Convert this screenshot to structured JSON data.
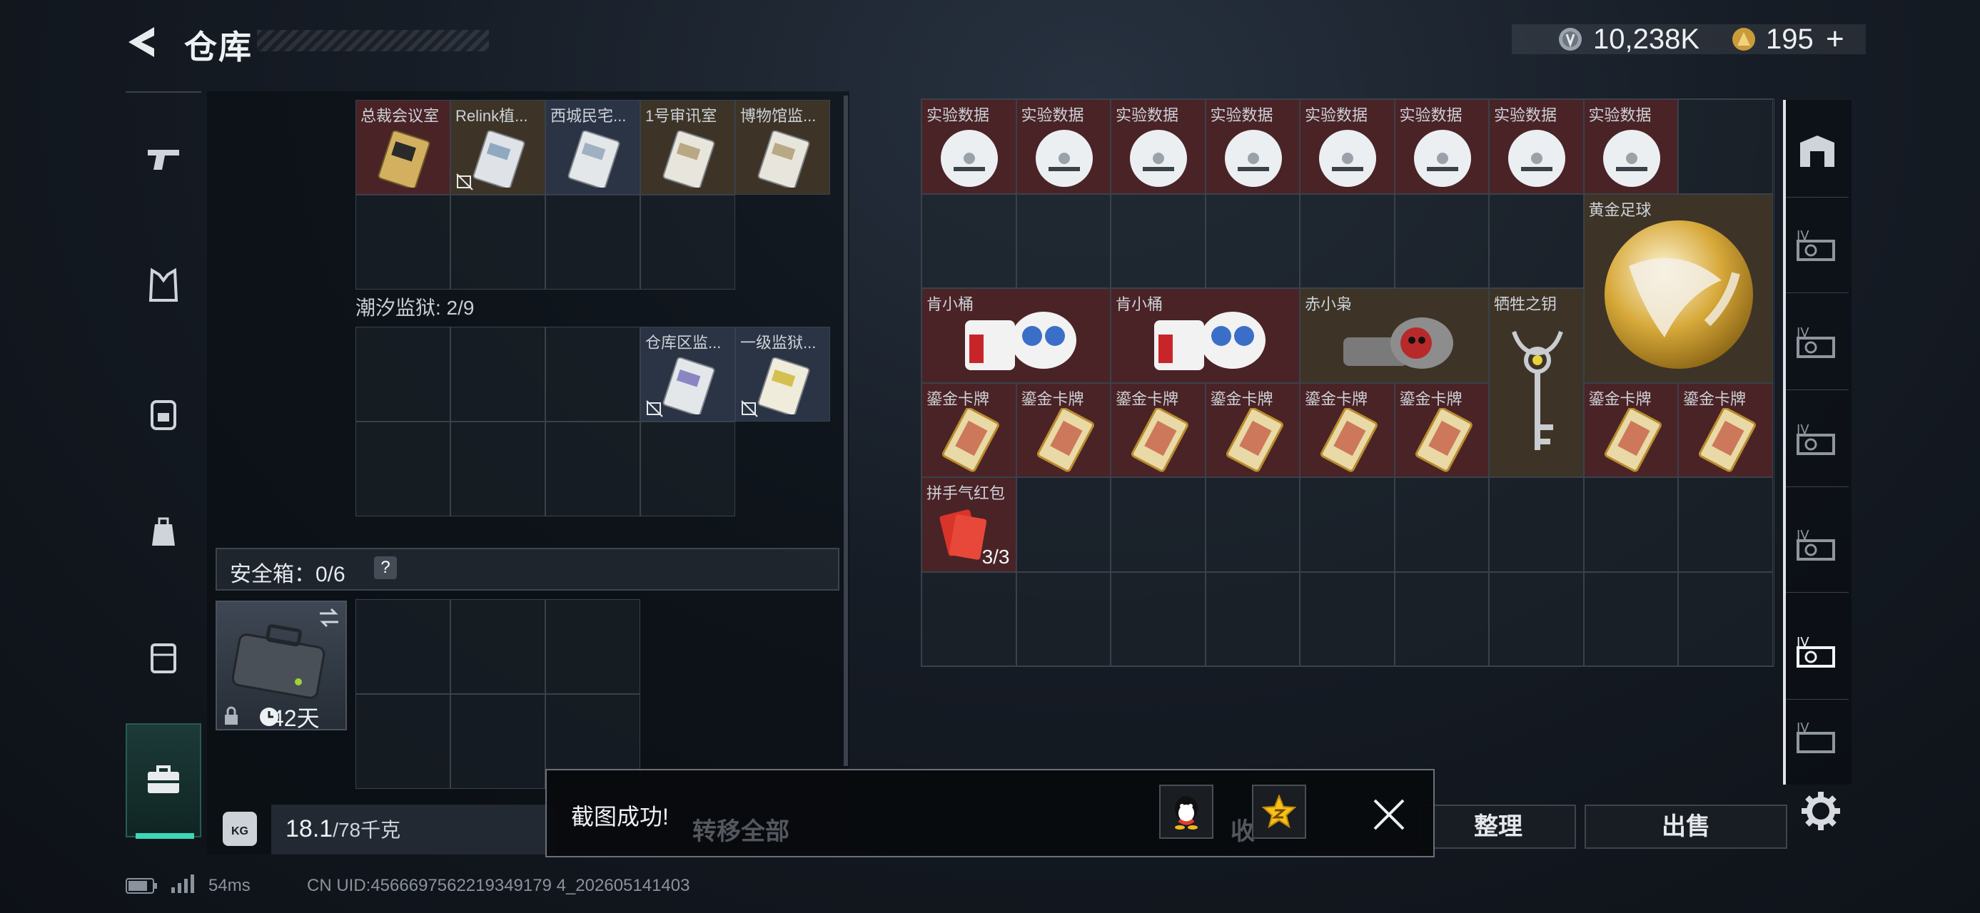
{
  "header": {
    "title": "仓库",
    "currency_silver": "10,238K",
    "currency_gold": "195",
    "currency_add": "+"
  },
  "left_nav": {
    "items": [
      "gun-icon",
      "armor-icon",
      "backpack-icon",
      "pouch-icon",
      "case-icon",
      "toolbox-icon"
    ],
    "active": 5
  },
  "keycards_top": [
    {
      "label": "总裁会议室",
      "tone": "dark",
      "locked": false
    },
    {
      "label": "Relink植...",
      "tone": "brown",
      "locked": true
    },
    {
      "label": "西城民宅...",
      "tone": "blue",
      "locked": false
    },
    {
      "label": "1号审讯室",
      "tone": "brown",
      "locked": false
    },
    {
      "label": "博物馆监...",
      "tone": "brown",
      "locked": false
    }
  ],
  "prison_section": {
    "label": "潮汐监狱: 2/9",
    "items": [
      {
        "label": "仓库区监...",
        "locked": true
      },
      {
        "label": "一级监狱...",
        "locked": true
      }
    ]
  },
  "safe_box": {
    "label": "安全箱：0/6",
    "help": "?",
    "days": "42天"
  },
  "weight": {
    "current": "18.1",
    "capacity": "/78千克",
    "kg_badge": "KG"
  },
  "storage": {
    "row1": [
      "实验数据",
      "实验数据",
      "实验数据",
      "实验数据",
      "实验数据",
      "实验数据",
      "实验数据",
      "实验数据"
    ],
    "gold_ball": "黄金足球",
    "row3": [
      "肯小桶",
      "肯小桶",
      "赤小枭",
      "牺牲之钥"
    ],
    "cards": [
      "鎏金卡牌",
      "鎏金卡牌",
      "鎏金卡牌",
      "鎏金卡牌",
      "鎏金卡牌",
      "鎏金卡牌",
      "鎏金卡牌",
      "鎏金卡牌"
    ],
    "red_packet": {
      "label": "拼手气红包",
      "count": "3/3"
    }
  },
  "buttons": {
    "transfer_all": "转移全部",
    "collect": "收",
    "organize": "整理",
    "sell": "出售"
  },
  "toast": {
    "message": "截图成功!"
  },
  "status": {
    "ping": "54ms",
    "uid": "CN UID:4566697562219349179 4_202605141403"
  },
  "colors": {
    "accent": "#3fd6b8",
    "item_red": "#4a2327",
    "item_blue": "#2b3445",
    "item_brown": "#3d3427"
  }
}
